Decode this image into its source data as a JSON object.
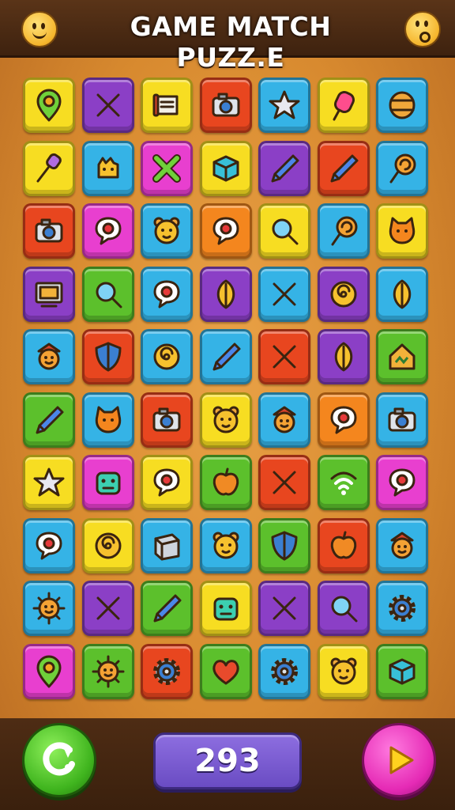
{
  "header": {
    "title": "GAME MATCH PUZZ.E",
    "left_icon": "smiley-face-icon",
    "right_icon": "surprised-face-icon"
  },
  "colors": {
    "yellow": "#f7dd22",
    "purple": "#8b3fc6",
    "red": "#e8461f",
    "blue": "#35b3e6",
    "magenta": "#e83fcf",
    "orange": "#f4861e",
    "green": "#5cc02c"
  },
  "board": {
    "rows": [
      [
        {
          "c": "yellow",
          "icon": "map-pin-icon"
        },
        {
          "c": "purple",
          "icon": "crossed-tools-icon"
        },
        {
          "c": "yellow",
          "icon": "scroll-icon"
        },
        {
          "c": "red",
          "icon": "camera-icon"
        },
        {
          "c": "blue",
          "icon": "star-icon"
        },
        {
          "c": "yellow",
          "icon": "popsicle-icon"
        },
        {
          "c": "blue",
          "icon": "barrel-icon"
        }
      ],
      [
        {
          "c": "yellow",
          "icon": "brush-icon"
        },
        {
          "c": "blue",
          "icon": "monster-icon"
        },
        {
          "c": "magenta",
          "icon": "cross-icon"
        },
        {
          "c": "yellow",
          "icon": "cube-icon"
        },
        {
          "c": "purple",
          "icon": "pencil-icon"
        },
        {
          "c": "red",
          "icon": "pencil-icon"
        },
        {
          "c": "blue",
          "icon": "lollipop-icon"
        }
      ],
      [
        {
          "c": "red",
          "icon": "camera-icon"
        },
        {
          "c": "magenta",
          "icon": "chat-bubble-icon"
        },
        {
          "c": "blue",
          "icon": "bear-icon"
        },
        {
          "c": "orange",
          "icon": "chat-bubble-icon"
        },
        {
          "c": "yellow",
          "icon": "magnifier-icon"
        },
        {
          "c": "blue",
          "icon": "lollipop-icon"
        },
        {
          "c": "yellow",
          "icon": "cat-face-icon"
        }
      ],
      [
        {
          "c": "purple",
          "icon": "monitor-icon"
        },
        {
          "c": "green",
          "icon": "magnifier-icon"
        },
        {
          "c": "blue",
          "icon": "chat-bubble-icon"
        },
        {
          "c": "purple",
          "icon": "leaf-icon"
        },
        {
          "c": "blue",
          "icon": "crossed-tools-icon"
        },
        {
          "c": "purple",
          "icon": "swirl-icon"
        },
        {
          "c": "blue",
          "icon": "leaf-icon"
        }
      ],
      [
        {
          "c": "blue",
          "icon": "face-icon"
        },
        {
          "c": "red",
          "icon": "shield-icon"
        },
        {
          "c": "blue",
          "icon": "swirl-icon"
        },
        {
          "c": "blue",
          "icon": "pencil-icon"
        },
        {
          "c": "red",
          "icon": "crossed-tools-icon"
        },
        {
          "c": "purple",
          "icon": "leaf-icon"
        },
        {
          "c": "green",
          "icon": "house-icon"
        }
      ],
      [
        {
          "c": "green",
          "icon": "pencil-icon"
        },
        {
          "c": "blue",
          "icon": "cat-face-icon"
        },
        {
          "c": "red",
          "icon": "camera-icon"
        },
        {
          "c": "yellow",
          "icon": "bear-icon"
        },
        {
          "c": "blue",
          "icon": "face-icon"
        },
        {
          "c": "orange",
          "icon": "chat-bubble-icon"
        },
        {
          "c": "blue",
          "icon": "camera-icon"
        }
      ],
      [
        {
          "c": "yellow",
          "icon": "star-icon"
        },
        {
          "c": "magenta",
          "icon": "robot-icon"
        },
        {
          "c": "yellow",
          "icon": "chat-bubble-icon"
        },
        {
          "c": "green",
          "icon": "apple-icon"
        },
        {
          "c": "red",
          "icon": "crossed-tools-icon"
        },
        {
          "c": "green",
          "icon": "wifi-icon"
        },
        {
          "c": "magenta",
          "icon": "chat-bubble-icon"
        }
      ],
      [
        {
          "c": "blue",
          "icon": "chat-bubble-icon"
        },
        {
          "c": "yellow",
          "icon": "swirl-icon"
        },
        {
          "c": "blue",
          "icon": "box-icon"
        },
        {
          "c": "blue",
          "icon": "bear-icon"
        },
        {
          "c": "green",
          "icon": "shield-icon"
        },
        {
          "c": "red",
          "icon": "apple-icon"
        },
        {
          "c": "blue",
          "icon": "face-icon"
        }
      ],
      [
        {
          "c": "blue",
          "icon": "sun-face-icon"
        },
        {
          "c": "purple",
          "icon": "crossed-tools-icon"
        },
        {
          "c": "green",
          "icon": "pencil-icon"
        },
        {
          "c": "yellow",
          "icon": "robot-icon"
        },
        {
          "c": "purple",
          "icon": "crossed-tools-icon"
        },
        {
          "c": "purple",
          "icon": "magnifier-icon"
        },
        {
          "c": "blue",
          "icon": "gear-icon"
        }
      ],
      [
        {
          "c": "magenta",
          "icon": "map-pin-icon"
        },
        {
          "c": "green",
          "icon": "sun-face-icon"
        },
        {
          "c": "red",
          "icon": "gear-icon"
        },
        {
          "c": "green",
          "icon": "heart-icon"
        },
        {
          "c": "blue",
          "icon": "gear-icon"
        },
        {
          "c": "yellow",
          "icon": "bear-icon"
        },
        {
          "c": "green",
          "icon": "cube-icon"
        }
      ]
    ]
  },
  "footer": {
    "score": "293",
    "left_button_icon": "restart-icon",
    "right_button_icon": "play-icon"
  }
}
